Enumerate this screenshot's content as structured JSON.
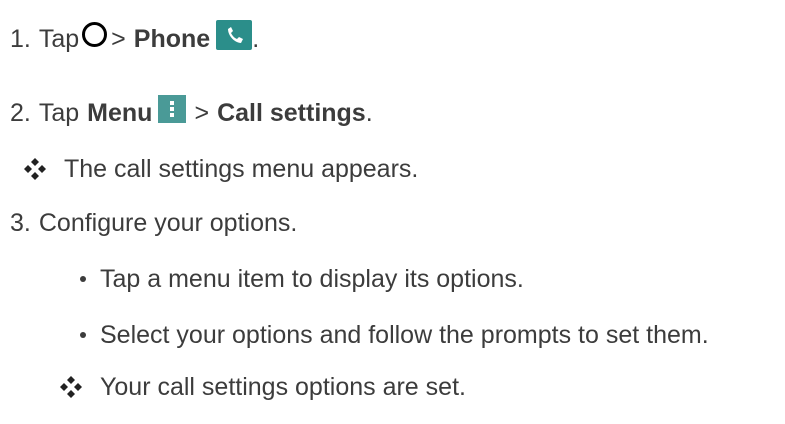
{
  "steps": [
    {
      "number": "1.",
      "tap": "Tap",
      "sep": ">",
      "target": "Phone",
      "end": "."
    },
    {
      "number": "2.",
      "tap": "Tap",
      "menu": "Menu",
      "sep": ">",
      "target": "Call settings",
      "end": "."
    },
    {
      "number": "3.",
      "text": "Configure your options."
    }
  ],
  "result_1": "The call settings menu appears.",
  "bullets": [
    "Tap a menu item to display its options.",
    "Select your options and follow the prompts to set them."
  ],
  "result_2": "Your call settings options are set.",
  "icons": {
    "home": "home-circle-icon",
    "phone": "phone-app-icon",
    "menu": "menu-dots-icon",
    "result": "diamond-bullet-icon"
  },
  "colors": {
    "text": "#3c3c3c",
    "phone_icon": "#2b8e8a",
    "menu_icon": "#4a9a97"
  }
}
